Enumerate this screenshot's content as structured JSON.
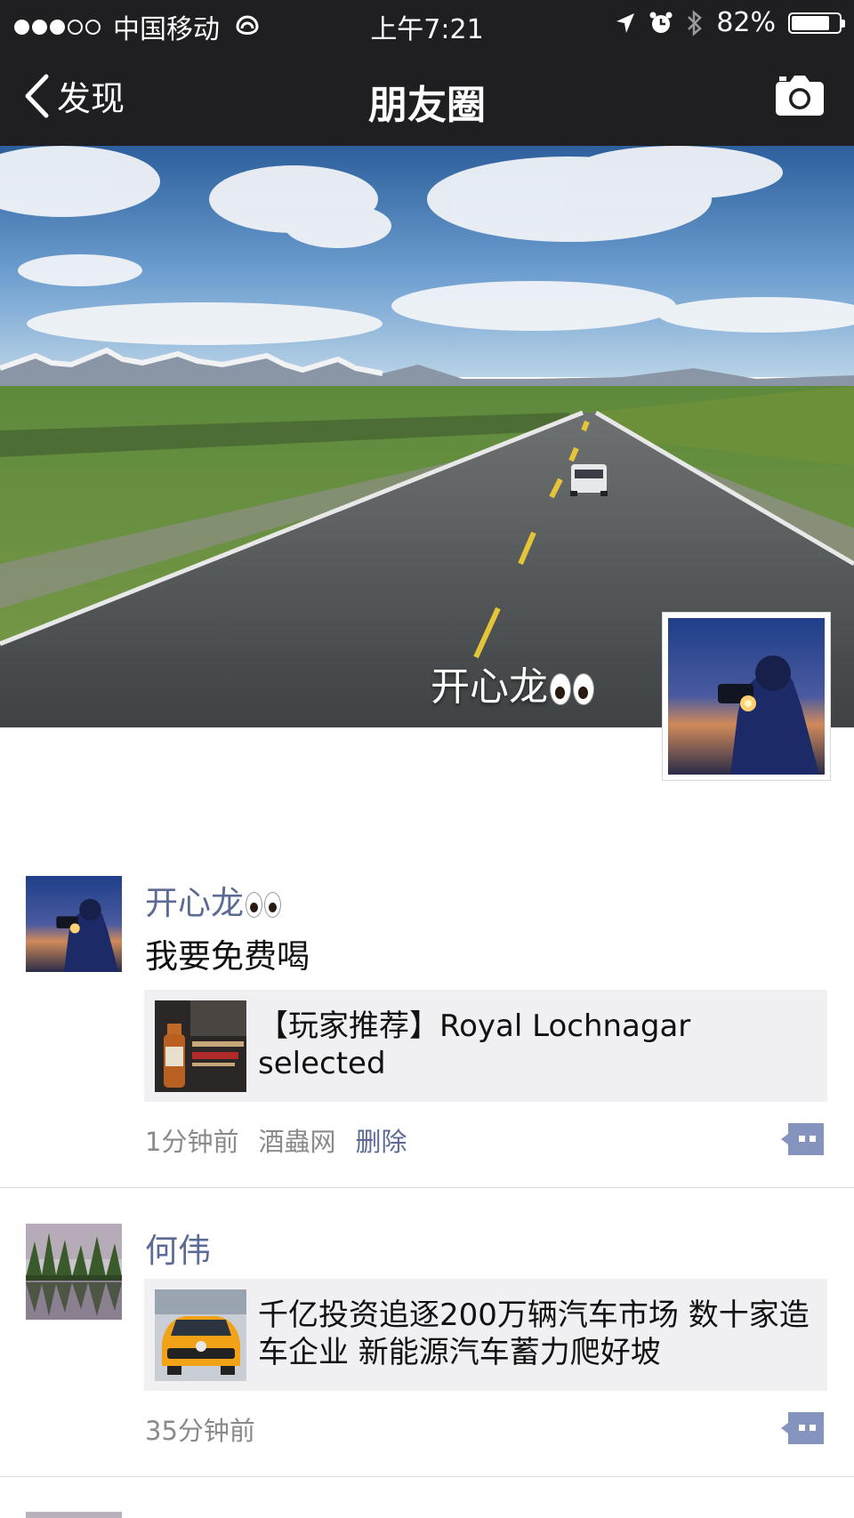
{
  "status_bar": {
    "carrier": "中国移动",
    "time": "上午7:21",
    "battery_percent": "82%",
    "battery_level": 0.82,
    "signal_bars_filled": 3,
    "signal_bars_total": 5
  },
  "nav": {
    "back_label": "发现",
    "title": "朋友圈"
  },
  "cover": {
    "owner_name": "开心龙"
  },
  "posts": [
    {
      "name": "开心龙",
      "text": "我要免费喝",
      "link_title": "【玩家推荐】Royal Lochnagar selected",
      "time": "1分钟前",
      "source": "酒蟲网",
      "delete_label": "删除"
    },
    {
      "name": "何伟",
      "link_title": "千亿投资追逐200万辆汽车市场 数十家造车企业 新能源汽车蓄力爬好坡",
      "time": "35分钟前"
    }
  ],
  "colors": {
    "bar_bg": "#1f1f22",
    "name_blue": "#5b6b95",
    "card_bg": "#f0f0f3",
    "meta_gray": "#8a8a8a"
  },
  "icons": [
    "chevron-left-icon",
    "camera-icon",
    "wifi-icon",
    "location-icon",
    "alarm-icon",
    "bluetooth-icon",
    "battery-icon",
    "comment-icon"
  ]
}
